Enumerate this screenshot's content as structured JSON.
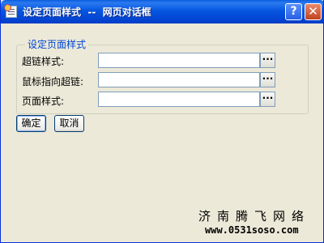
{
  "window": {
    "title": "设定页面样式  --  网页对话框",
    "help_label": "?",
    "close_label": "✕"
  },
  "group": {
    "legend": "设定页面样式",
    "fields": [
      {
        "label": "超链样式:",
        "value": "",
        "browse_label": "···"
      },
      {
        "label": "鼠标指向超链:",
        "value": "",
        "browse_label": "···"
      },
      {
        "label": "页面样式:",
        "value": "",
        "browse_label": "···"
      }
    ]
  },
  "buttons": {
    "ok_label": "确定",
    "cancel_label": "取消"
  },
  "watermark": {
    "name": "济南腾飞网络",
    "url": "www.0531soso.com"
  },
  "colors": {
    "titlebar": "#0556e0",
    "dialog_bg": "#ece9d8",
    "legend_text": "#0046d5",
    "close_button": "#c1421f"
  }
}
